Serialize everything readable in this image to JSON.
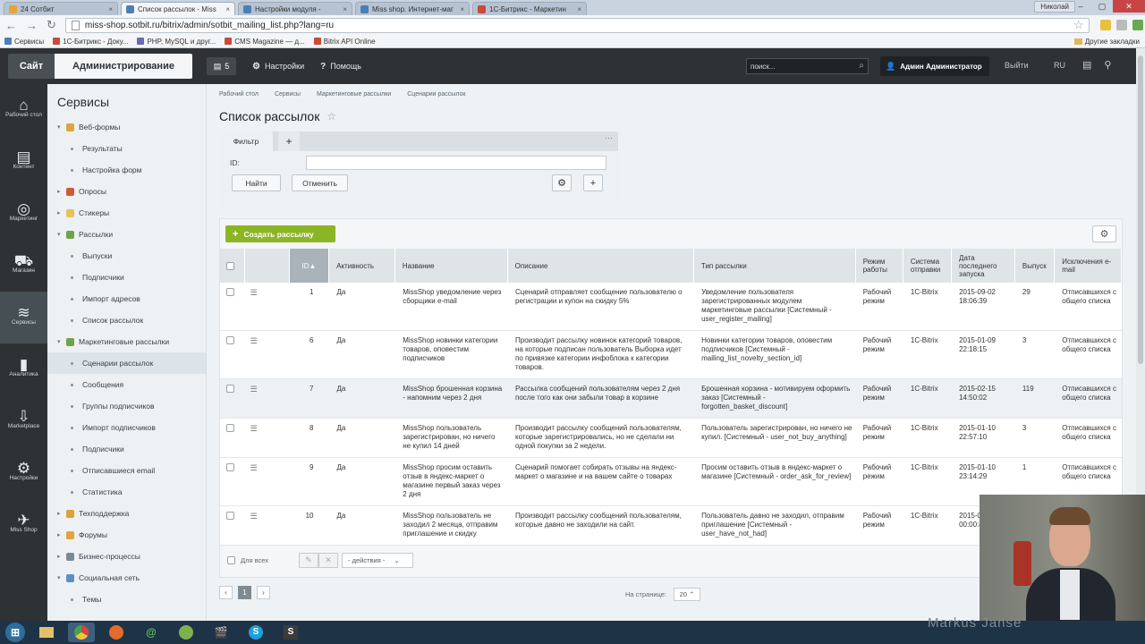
{
  "browser": {
    "tabs": [
      {
        "label": "24 Сотбит",
        "color": "#e6a23b",
        "active": false
      },
      {
        "label": "Список рассылок - Miss",
        "color": "#4a7fb5",
        "active": true
      },
      {
        "label": "Настройки модуля -",
        "color": "#4a7fb5",
        "active": false
      },
      {
        "label": "Miss shop. Интернет-маг",
        "color": "#4a7fb5",
        "active": false
      },
      {
        "label": "1С-Битрикс - Маркетин",
        "color": "#c94b3c",
        "active": false
      }
    ],
    "user_chip": "Николай",
    "url": "miss-shop.sotbit.ru/bitrix/admin/sotbit_mailing_list.php?lang=ru",
    "bookmarks": [
      "Сервисы",
      "1С-Битрикс - Доку...",
      "PHP, MySQL и друг...",
      "CMS Magazine — д...",
      "Bitrix API Online"
    ],
    "other_bookmarks": "Другие закладки"
  },
  "topbar": {
    "site_label": "Сайт",
    "admin_label": "Администрирование",
    "notif_count": "5",
    "settings_label": "Настройки",
    "help_label": "Помощь",
    "search_placeholder": "поиск...",
    "user_label": "Админ Администратор",
    "logout_label": "Выйти",
    "lang_label": "RU"
  },
  "leftnav": [
    {
      "glyph": "⌂",
      "label": "Рабочий стол"
    },
    {
      "glyph": "▤",
      "label": "Контент"
    },
    {
      "glyph": "◎",
      "label": "Маркетинг"
    },
    {
      "glyph": "⛟",
      "label": "Магазин"
    },
    {
      "glyph": "≋",
      "label": "Сервисы",
      "active": true
    },
    {
      "glyph": "▮",
      "label": "Аналитика"
    },
    {
      "glyph": "⇩",
      "label": "Marketplace"
    },
    {
      "glyph": "⚙",
      "label": "Настройки"
    },
    {
      "glyph": "✈",
      "label": "Miss Shop"
    }
  ],
  "sidebar": {
    "title": "Сервисы",
    "items": [
      {
        "label": "Веб-формы",
        "level": 1,
        "expanded": true,
        "color": "#e0a53a"
      },
      {
        "label": "Результаты",
        "level": 2
      },
      {
        "label": "Настройка форм",
        "level": 2
      },
      {
        "label": "Опросы",
        "level": 1,
        "expanded": false,
        "color": "#d05a3c"
      },
      {
        "label": "Стикеры",
        "level": 1,
        "expanded": false,
        "color": "#e8c25a"
      },
      {
        "label": "Рассылки",
        "level": 1,
        "expanded": true,
        "color": "#6fa34a"
      },
      {
        "label": "Выпуски",
        "level": 2
      },
      {
        "label": "Подписчики",
        "level": 2
      },
      {
        "label": "Импорт адресов",
        "level": 2
      },
      {
        "label": "Список рассылок",
        "level": 2
      },
      {
        "label": "Маркетинговые рассылки",
        "level": 1,
        "expanded": true,
        "color": "#6fa34a"
      },
      {
        "label": "Сценарии рассылок",
        "level": 2,
        "active": true
      },
      {
        "label": "Сообщения",
        "level": 2
      },
      {
        "label": "Группы подписчиков",
        "level": 2
      },
      {
        "label": "Импорт подписчиков",
        "level": 2
      },
      {
        "label": "Подписчики",
        "level": 2
      },
      {
        "label": "Отписавшиеся email",
        "level": 2
      },
      {
        "label": "Статистика",
        "level": 2
      },
      {
        "label": "Техподдержка",
        "level": 1,
        "expanded": false,
        "color": "#d8a33a"
      },
      {
        "label": "Форумы",
        "level": 1,
        "expanded": false,
        "color": "#e0a53a"
      },
      {
        "label": "Бизнес-процессы",
        "level": 1,
        "expanded": false,
        "color": "#7c8a93"
      },
      {
        "label": "Социальная сеть",
        "level": 1,
        "expanded": true,
        "color": "#5e8fc4"
      },
      {
        "label": "Темы",
        "level": 2
      }
    ]
  },
  "main": {
    "breadcrumbs": [
      "Рабочий стол",
      "Сервисы",
      "Маркетинговые рассылки",
      "Сценарии рассылок"
    ],
    "title": "Список рассылок",
    "filter": {
      "tab_label": "Фильтр",
      "id_label": "ID:",
      "id_value": "",
      "find_label": "Найти",
      "cancel_label": "Отменить"
    },
    "create_label": "Создать рассылку",
    "columns": [
      "ID",
      "Активность",
      "Название",
      "Описание",
      "Тип рассылки",
      "Режим работы",
      "Система отправки",
      "Дата последнего запуска",
      "Выпуск",
      "Исключения e-mail"
    ],
    "rows": [
      {
        "id": "1",
        "active": "Да",
        "name": "MissShop уведомление через сборщики e-mail",
        "desc": "Сценарий отправляет сообщение пользователю о регистрации и купон на скидку 5%",
        "type": "Уведомление пользователя зарегистрированных модулем маркетинговые рассылки [Системный - user_register_mailing]",
        "mode": "Рабочий режим",
        "system": "1C-Bitrix",
        "date": "2015-09-02 18:06:39",
        "issue": "29",
        "excl": "Отписавшихся с общего списка"
      },
      {
        "id": "6",
        "active": "Да",
        "name": "MissShop новинки категории товаров, оповестим подписчиков",
        "desc": "Производит рассылку новинок категорий товаров, на которые подписан пользователь Выборка идет по привязке категории инфоблока к категории товаров.",
        "type": "Новинки категории товаров, оповестим подписчиков [Системный - mailing_list_novelty_section_id]",
        "mode": "Рабочий режим",
        "system": "1C-Bitrix",
        "date": "2015-01-09 22:18:15",
        "issue": "3",
        "excl": "Отписавшихся с общего списка"
      },
      {
        "id": "7",
        "active": "Да",
        "name": "MissShop брошенная корзина - напомним через 2 дня",
        "desc": "Рассылка сообщений пользователям через 2 дня после того как они забыли товар в корзине",
        "type": "Брошенная корзина - мотивируем оформить заказ [Системный - forgotten_basket_discount]",
        "mode": "Рабочий режим",
        "system": "1C-Bitrix",
        "date": "2015-02-15 14:50:02",
        "issue": "119",
        "excl": "Отписавшихся с общего списка"
      },
      {
        "id": "8",
        "active": "Да",
        "name": "MissShop пользователь зарегистрирован, но ничего не купил 14 дней",
        "desc": "Производит рассылку сообщений пользователям, которые зарегистрировались, но не сделали ни одной покупки за 2 недели.",
        "type": "Пользователь зарегистрирован, но ничего не купил. [Системный - user_not_buy_anything]",
        "mode": "Рабочий режим",
        "system": "1C-Bitrix",
        "date": "2015-01-10 22:57:10",
        "issue": "3",
        "excl": "Отписавшихся с общего списка"
      },
      {
        "id": "9",
        "active": "Да",
        "name": "MissShop просим оставить отзыв в яндекс-маркет о магазине первый заказ через 2 дня",
        "desc": "Сценарий помогает собирать отзывы на яндекс-маркет о магазине и на вашем сайте о товарах",
        "type": "Просим оставить отзыв в яндекс-маркет о магазине [Системный - order_ask_for_review]",
        "mode": "Рабочий режим",
        "system": "1C-Bitrix",
        "date": "2015-01-10 23:14:29",
        "issue": "1",
        "excl": "Отписавшихся с общего списка"
      },
      {
        "id": "10",
        "active": "Да",
        "name": "MissShop пользователь не заходил 2 месяца, отправим приглашение и скидку",
        "desc": "Производит рассылку сообщений пользователям, которые давно не заходили на сайт.",
        "type": "Пользователь давно не заходил, отправим приглашение [Системный - user_have_not_had]",
        "mode": "Рабочий режим",
        "system": "1C-Bitrix",
        "date": "2015-01- 00:00:41",
        "issue": "",
        "excl": ""
      }
    ],
    "for_all_label": "Для всех",
    "actions_label": "- действия -",
    "page": "1",
    "per_page_label": "На странице:",
    "per_page_value": "20"
  },
  "taskbar": {
    "overlay_text": "Markus Janse"
  }
}
